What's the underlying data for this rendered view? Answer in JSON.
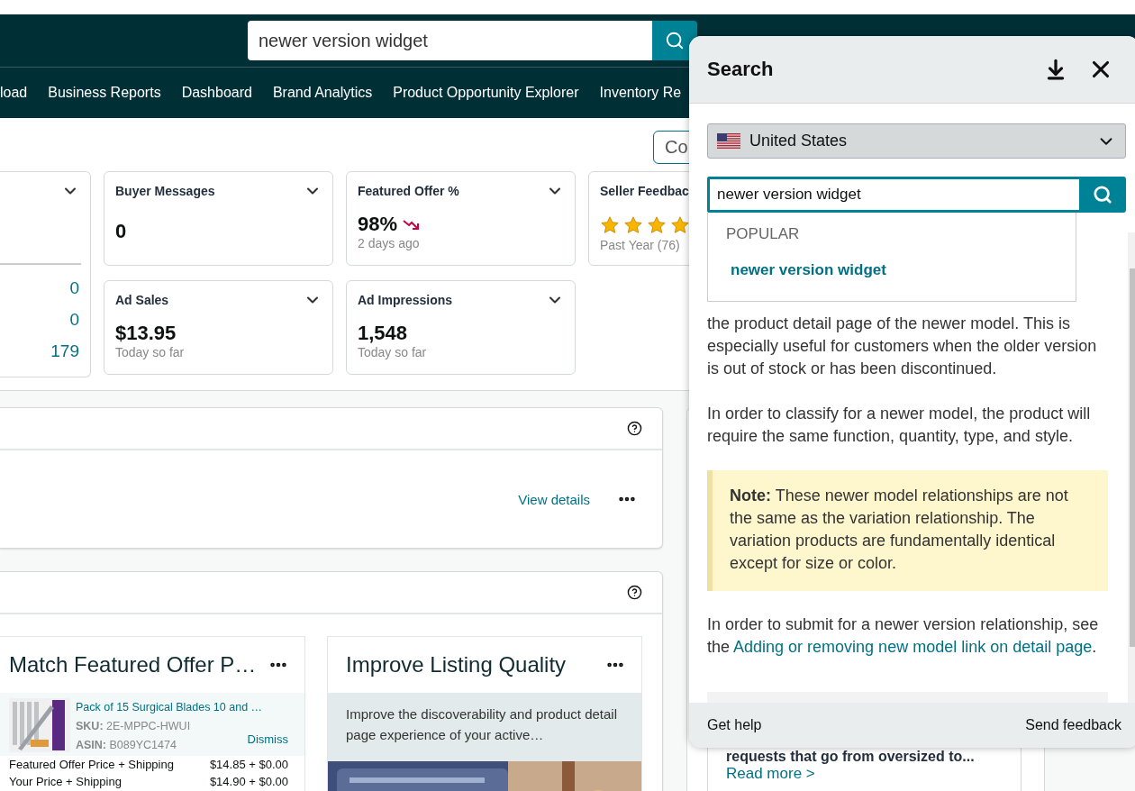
{
  "header": {
    "search": {
      "value": "newer version widget"
    }
  },
  "nav": {
    "items": [
      "load",
      "Business Reports",
      "Dashboard",
      "Brand Analytics",
      "Product Opportunity Explorer",
      "Inventory Re"
    ]
  },
  "toolbar": {
    "button": "Co"
  },
  "metrics": {
    "partial_card": {
      "values": [
        "0",
        "0",
        "179"
      ]
    },
    "cards": [
      {
        "kind": "count",
        "title": "Buyer Messages",
        "value": "0"
      },
      {
        "kind": "trend",
        "title": "Featured Offer %",
        "value": "98%",
        "trending_down": true,
        "caption": "2 days ago"
      },
      {
        "kind": "stars",
        "title": "Seller Feedbac",
        "stars": 4,
        "caption": "Past Year (76)"
      },
      {
        "kind": "count",
        "title": "Ad Sales",
        "value": "$13.95",
        "caption": "Today so far"
      },
      {
        "kind": "count",
        "title": "Ad Impressions",
        "value": "1,548",
        "caption": "Today so far"
      }
    ]
  },
  "summary_panel": {
    "link": "View details"
  },
  "recommendations": {
    "cards": [
      {
        "kind": "offer",
        "title": "Match Featured Offer P…",
        "product": {
          "title": "Pack of 15 Surgical Blades 10 and …",
          "sku_label": "SKU:",
          "sku": "2E-MPPC-HWUI",
          "asin_label": "ASIN:",
          "asin": "B089YC1474",
          "action": "Dismiss"
        },
        "rows": [
          {
            "label": "Featured Offer Price + Shipping",
            "value": "$14.85 + $0.00"
          },
          {
            "label": "Your Price + Shipping",
            "value": "$14.90 + $0.00"
          }
        ]
      },
      {
        "kind": "listing",
        "title": "Improve Listing Quality",
        "description": "Improve the discoverability and product detail page experience of your active…"
      }
    ]
  },
  "news_card": {
    "headline": "requests that go from oversized to...",
    "link": "Read more >"
  },
  "search_panel": {
    "title": "Search",
    "marketplace": "United States",
    "query": "newer version widget",
    "suggestions": {
      "heading": "POPULAR",
      "items": [
        "newer version widget"
      ]
    },
    "article": [
      {
        "kind": "paragraph",
        "text": "the product detail page of the newer model. This is especially useful for customers when the older version is out of stock or has been discontinued."
      },
      {
        "kind": "paragraph",
        "text": "In order to classify for a newer model, the product will require the same function, quantity, type, and style."
      },
      {
        "kind": "note",
        "text": "**Note:** These newer model relationships are not the same as the variation relationship. The variation products are fundamentally identical except for size or color."
      },
      {
        "kind": "paragraph",
        "text": "In order to submit for a newer version relationship, see the ",
        "link": "Adding or removing new model link on detail page",
        "after": "."
      }
    ],
    "footer": {
      "help": "Get help",
      "feedback": "Send feedback"
    }
  }
}
